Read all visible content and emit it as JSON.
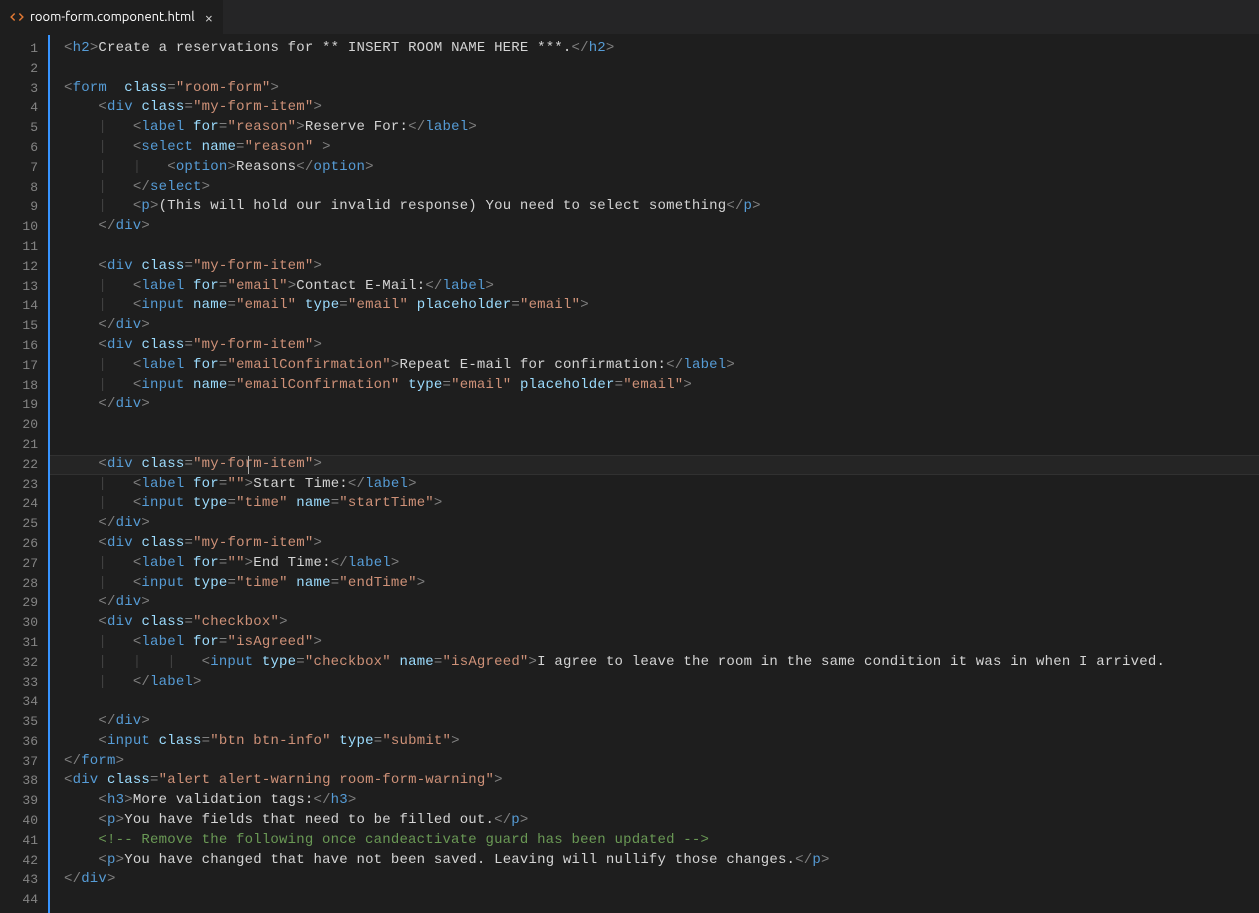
{
  "tab": {
    "filename": "room-form.component.html",
    "close_glyph": "×"
  },
  "gutter": {
    "start": 1,
    "end": 44
  },
  "code": {
    "lines": [
      [
        [
          "p",
          "<"
        ],
        [
          "tg",
          "h2"
        ],
        [
          "p",
          ">"
        ],
        [
          "tx",
          "Create a reservations for ** INSERT ROOM NAME HERE ***."
        ],
        [
          "p",
          "</"
        ],
        [
          "tg",
          "h2"
        ],
        [
          "p",
          ">"
        ]
      ],
      [],
      [
        [
          "p",
          "<"
        ],
        [
          "tg",
          "form"
        ],
        [
          "tx",
          "  "
        ],
        [
          "at",
          "class"
        ],
        [
          "p",
          "="
        ],
        [
          "st",
          "\"room-form\""
        ],
        [
          "p",
          ">"
        ]
      ],
      [
        [
          "tx",
          "    "
        ],
        [
          "p",
          "<"
        ],
        [
          "tg",
          "div"
        ],
        [
          "tx",
          " "
        ],
        [
          "at",
          "class"
        ],
        [
          "p",
          "="
        ],
        [
          "st",
          "\"my-form-item\""
        ],
        [
          "p",
          ">"
        ]
      ],
      [
        [
          "tx",
          "    "
        ],
        [
          "guide",
          "|   "
        ],
        [
          "p",
          "<"
        ],
        [
          "tg",
          "label"
        ],
        [
          "tx",
          " "
        ],
        [
          "at",
          "for"
        ],
        [
          "p",
          "="
        ],
        [
          "st",
          "\"reason\""
        ],
        [
          "p",
          ">"
        ],
        [
          "tx",
          "Reserve For:"
        ],
        [
          "p",
          "</"
        ],
        [
          "tg",
          "label"
        ],
        [
          "p",
          ">"
        ]
      ],
      [
        [
          "tx",
          "    "
        ],
        [
          "guide",
          "|   "
        ],
        [
          "p",
          "<"
        ],
        [
          "tg",
          "select"
        ],
        [
          "tx",
          " "
        ],
        [
          "at",
          "name"
        ],
        [
          "p",
          "="
        ],
        [
          "st",
          "\"reason\""
        ],
        [
          "tx",
          " "
        ],
        [
          "p",
          ">"
        ]
      ],
      [
        [
          "tx",
          "    "
        ],
        [
          "guide",
          "|   |   "
        ],
        [
          "p",
          "<"
        ],
        [
          "tg",
          "option"
        ],
        [
          "p",
          ">"
        ],
        [
          "tx",
          "Reasons"
        ],
        [
          "p",
          "</"
        ],
        [
          "tg",
          "option"
        ],
        [
          "p",
          ">"
        ]
      ],
      [
        [
          "tx",
          "    "
        ],
        [
          "guide",
          "|   "
        ],
        [
          "p",
          "</"
        ],
        [
          "tg",
          "select"
        ],
        [
          "p",
          ">"
        ]
      ],
      [
        [
          "tx",
          "    "
        ],
        [
          "guide",
          "|   "
        ],
        [
          "p",
          "<"
        ],
        [
          "tg",
          "p"
        ],
        [
          "p",
          ">"
        ],
        [
          "tx",
          "(This will hold our invalid response) You need to select something"
        ],
        [
          "p",
          "</"
        ],
        [
          "tg",
          "p"
        ],
        [
          "p",
          ">"
        ]
      ],
      [
        [
          "tx",
          "    "
        ],
        [
          "p",
          "</"
        ],
        [
          "tg",
          "div"
        ],
        [
          "p",
          ">"
        ]
      ],
      [],
      [
        [
          "tx",
          "    "
        ],
        [
          "p",
          "<"
        ],
        [
          "tg",
          "div"
        ],
        [
          "tx",
          " "
        ],
        [
          "at",
          "class"
        ],
        [
          "p",
          "="
        ],
        [
          "st",
          "\"my-form-item\""
        ],
        [
          "p",
          ">"
        ]
      ],
      [
        [
          "tx",
          "    "
        ],
        [
          "guide",
          "|   "
        ],
        [
          "p",
          "<"
        ],
        [
          "tg",
          "label"
        ],
        [
          "tx",
          " "
        ],
        [
          "at",
          "for"
        ],
        [
          "p",
          "="
        ],
        [
          "st",
          "\"email\""
        ],
        [
          "p",
          ">"
        ],
        [
          "tx",
          "Contact E-Mail:"
        ],
        [
          "p",
          "</"
        ],
        [
          "tg",
          "label"
        ],
        [
          "p",
          ">"
        ]
      ],
      [
        [
          "tx",
          "    "
        ],
        [
          "guide",
          "|   "
        ],
        [
          "p",
          "<"
        ],
        [
          "tg",
          "input"
        ],
        [
          "tx",
          " "
        ],
        [
          "at",
          "name"
        ],
        [
          "p",
          "="
        ],
        [
          "st",
          "\"email\""
        ],
        [
          "tx",
          " "
        ],
        [
          "at",
          "type"
        ],
        [
          "p",
          "="
        ],
        [
          "st",
          "\"email\""
        ],
        [
          "tx",
          " "
        ],
        [
          "at",
          "placeholder"
        ],
        [
          "p",
          "="
        ],
        [
          "st",
          "\"email\""
        ],
        [
          "p",
          ">"
        ]
      ],
      [
        [
          "tx",
          "    "
        ],
        [
          "p",
          "</"
        ],
        [
          "tg",
          "div"
        ],
        [
          "p",
          ">"
        ]
      ],
      [
        [
          "tx",
          "    "
        ],
        [
          "p",
          "<"
        ],
        [
          "tg",
          "div"
        ],
        [
          "tx",
          " "
        ],
        [
          "at",
          "class"
        ],
        [
          "p",
          "="
        ],
        [
          "st",
          "\"my-form-item\""
        ],
        [
          "p",
          ">"
        ]
      ],
      [
        [
          "tx",
          "    "
        ],
        [
          "guide",
          "|   "
        ],
        [
          "p",
          "<"
        ],
        [
          "tg",
          "label"
        ],
        [
          "tx",
          " "
        ],
        [
          "at",
          "for"
        ],
        [
          "p",
          "="
        ],
        [
          "st",
          "\"emailConfirmation\""
        ],
        [
          "p",
          ">"
        ],
        [
          "tx",
          "Repeat E-mail for confirmation:"
        ],
        [
          "p",
          "</"
        ],
        [
          "tg",
          "label"
        ],
        [
          "p",
          ">"
        ]
      ],
      [
        [
          "tx",
          "    "
        ],
        [
          "guide",
          "|   "
        ],
        [
          "p",
          "<"
        ],
        [
          "tg",
          "input"
        ],
        [
          "tx",
          " "
        ],
        [
          "at",
          "name"
        ],
        [
          "p",
          "="
        ],
        [
          "st",
          "\"emailConfirmation\""
        ],
        [
          "tx",
          " "
        ],
        [
          "at",
          "type"
        ],
        [
          "p",
          "="
        ],
        [
          "st",
          "\"email\""
        ],
        [
          "tx",
          " "
        ],
        [
          "at",
          "placeholder"
        ],
        [
          "p",
          "="
        ],
        [
          "st",
          "\"email\""
        ],
        [
          "p",
          ">"
        ]
      ],
      [
        [
          "tx",
          "    "
        ],
        [
          "p",
          "</"
        ],
        [
          "tg",
          "div"
        ],
        [
          "p",
          ">"
        ]
      ],
      [],
      [],
      [
        [
          "tx",
          "    "
        ],
        [
          "p",
          "<"
        ],
        [
          "tg",
          "div"
        ],
        [
          "tx",
          " "
        ],
        [
          "at",
          "class"
        ],
        [
          "p",
          "="
        ],
        [
          "st",
          "\"my-form-item\""
        ],
        [
          "p",
          ">"
        ]
      ],
      [
        [
          "tx",
          "    "
        ],
        [
          "guide",
          "|   "
        ],
        [
          "p",
          "<"
        ],
        [
          "tg",
          "label"
        ],
        [
          "tx",
          " "
        ],
        [
          "at",
          "for"
        ],
        [
          "p",
          "="
        ],
        [
          "st",
          "\"\""
        ],
        [
          "p",
          ">"
        ],
        [
          "tx",
          "Start Time:"
        ],
        [
          "p",
          "</"
        ],
        [
          "tg",
          "label"
        ],
        [
          "p",
          ">"
        ]
      ],
      [
        [
          "tx",
          "    "
        ],
        [
          "guide",
          "|   "
        ],
        [
          "p",
          "<"
        ],
        [
          "tg",
          "input"
        ],
        [
          "tx",
          " "
        ],
        [
          "at",
          "type"
        ],
        [
          "p",
          "="
        ],
        [
          "st",
          "\"time\""
        ],
        [
          "tx",
          " "
        ],
        [
          "at",
          "name"
        ],
        [
          "p",
          "="
        ],
        [
          "st",
          "\"startTime\""
        ],
        [
          "p",
          ">"
        ]
      ],
      [
        [
          "tx",
          "    "
        ],
        [
          "p",
          "</"
        ],
        [
          "tg",
          "div"
        ],
        [
          "p",
          ">"
        ]
      ],
      [
        [
          "tx",
          "    "
        ],
        [
          "p",
          "<"
        ],
        [
          "tg",
          "div"
        ],
        [
          "tx",
          " "
        ],
        [
          "at",
          "class"
        ],
        [
          "p",
          "="
        ],
        [
          "st",
          "\"my-form-item\""
        ],
        [
          "p",
          ">"
        ]
      ],
      [
        [
          "tx",
          "    "
        ],
        [
          "guide",
          "|   "
        ],
        [
          "p",
          "<"
        ],
        [
          "tg",
          "label"
        ],
        [
          "tx",
          " "
        ],
        [
          "at",
          "for"
        ],
        [
          "p",
          "="
        ],
        [
          "st",
          "\"\""
        ],
        [
          "p",
          ">"
        ],
        [
          "tx",
          "End Time:"
        ],
        [
          "p",
          "</"
        ],
        [
          "tg",
          "label"
        ],
        [
          "p",
          ">"
        ]
      ],
      [
        [
          "tx",
          "    "
        ],
        [
          "guide",
          "|   "
        ],
        [
          "p",
          "<"
        ],
        [
          "tg",
          "input"
        ],
        [
          "tx",
          " "
        ],
        [
          "at",
          "type"
        ],
        [
          "p",
          "="
        ],
        [
          "st",
          "\"time\""
        ],
        [
          "tx",
          " "
        ],
        [
          "at",
          "name"
        ],
        [
          "p",
          "="
        ],
        [
          "st",
          "\"endTime\""
        ],
        [
          "p",
          ">"
        ]
      ],
      [
        [
          "tx",
          "    "
        ],
        [
          "p",
          "</"
        ],
        [
          "tg",
          "div"
        ],
        [
          "p",
          ">"
        ]
      ],
      [
        [
          "tx",
          "    "
        ],
        [
          "p",
          "<"
        ],
        [
          "tg",
          "div"
        ],
        [
          "tx",
          " "
        ],
        [
          "at",
          "class"
        ],
        [
          "p",
          "="
        ],
        [
          "st",
          "\"checkbox\""
        ],
        [
          "p",
          ">"
        ]
      ],
      [
        [
          "tx",
          "    "
        ],
        [
          "guide",
          "|   "
        ],
        [
          "p",
          "<"
        ],
        [
          "tg",
          "label"
        ],
        [
          "tx",
          " "
        ],
        [
          "at",
          "for"
        ],
        [
          "p",
          "="
        ],
        [
          "st",
          "\"isAgreed\""
        ],
        [
          "p",
          ">"
        ]
      ],
      [
        [
          "tx",
          "    "
        ],
        [
          "guide",
          "|   |   |   "
        ],
        [
          "p",
          "<"
        ],
        [
          "tg",
          "input"
        ],
        [
          "tx",
          " "
        ],
        [
          "at",
          "type"
        ],
        [
          "p",
          "="
        ],
        [
          "st",
          "\"checkbox\""
        ],
        [
          "tx",
          " "
        ],
        [
          "at",
          "name"
        ],
        [
          "p",
          "="
        ],
        [
          "st",
          "\"isAgreed\""
        ],
        [
          "p",
          ">"
        ],
        [
          "tx",
          "I agree to leave the room in the same condition it was in when I arrived."
        ]
      ],
      [
        [
          "tx",
          "    "
        ],
        [
          "guide",
          "|   "
        ],
        [
          "p",
          "</"
        ],
        [
          "tg",
          "label"
        ],
        [
          "p",
          ">"
        ]
      ],
      [],
      [
        [
          "tx",
          "    "
        ],
        [
          "p",
          "</"
        ],
        [
          "tg",
          "div"
        ],
        [
          "p",
          ">"
        ]
      ],
      [
        [
          "tx",
          "    "
        ],
        [
          "p",
          "<"
        ],
        [
          "tg",
          "input"
        ],
        [
          "tx",
          " "
        ],
        [
          "at",
          "class"
        ],
        [
          "p",
          "="
        ],
        [
          "st",
          "\"btn btn-info\""
        ],
        [
          "tx",
          " "
        ],
        [
          "at",
          "type"
        ],
        [
          "p",
          "="
        ],
        [
          "st",
          "\"submit\""
        ],
        [
          "p",
          ">"
        ]
      ],
      [
        [
          "p",
          "</"
        ],
        [
          "tg",
          "form"
        ],
        [
          "p",
          ">"
        ]
      ],
      [
        [
          "p",
          "<"
        ],
        [
          "tg",
          "div"
        ],
        [
          "tx",
          " "
        ],
        [
          "at",
          "class"
        ],
        [
          "p",
          "="
        ],
        [
          "st",
          "\"alert alert-warning room-form-warning\""
        ],
        [
          "p",
          ">"
        ]
      ],
      [
        [
          "tx",
          "    "
        ],
        [
          "p",
          "<"
        ],
        [
          "tg",
          "h3"
        ],
        [
          "p",
          ">"
        ],
        [
          "tx",
          "More validation tags:"
        ],
        [
          "p",
          "</"
        ],
        [
          "tg",
          "h3"
        ],
        [
          "p",
          ">"
        ]
      ],
      [
        [
          "tx",
          "    "
        ],
        [
          "p",
          "<"
        ],
        [
          "tg",
          "p"
        ],
        [
          "p",
          ">"
        ],
        [
          "tx",
          "You have fields that need to be filled out."
        ],
        [
          "p",
          "</"
        ],
        [
          "tg",
          "p"
        ],
        [
          "p",
          ">"
        ]
      ],
      [
        [
          "tx",
          "    "
        ],
        [
          "cm",
          "<!-- Remove the following once candeactivate guard has been updated -->"
        ]
      ],
      [
        [
          "tx",
          "    "
        ],
        [
          "p",
          "<"
        ],
        [
          "tg",
          "p"
        ],
        [
          "p",
          ">"
        ],
        [
          "tx",
          "You have changed that have not been saved. Leaving will nullify those changes."
        ],
        [
          "p",
          "</"
        ],
        [
          "tg",
          "p"
        ],
        [
          "p",
          ">"
        ]
      ],
      [
        [
          "p",
          "</"
        ],
        [
          "tg",
          "div"
        ],
        [
          "p",
          ">"
        ]
      ],
      []
    ]
  },
  "active_line": 22
}
